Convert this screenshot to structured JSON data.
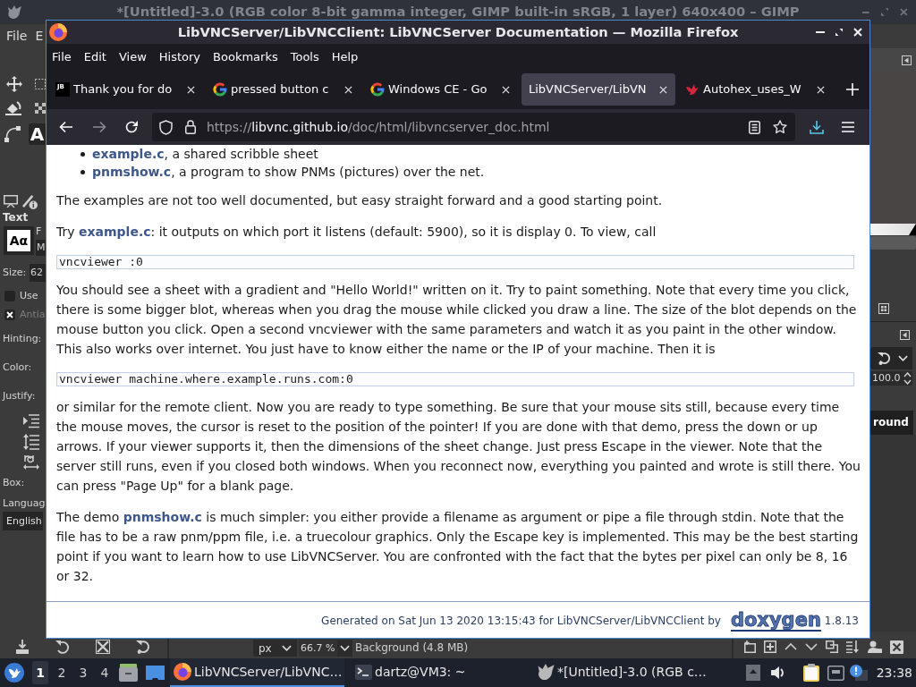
{
  "gimp": {
    "title": "*[Untitled]-3.0 (RGB color 8-bit gamma integer, GIMP built-in sRGB, 1 layer) 640x400 – GIMP",
    "menu": [
      "File",
      "E"
    ],
    "active_tool": "A",
    "tool_options": {
      "heading": "Text",
      "font_preview": "Aα",
      "font_label": "F",
      "font_value": "M",
      "size_label": "Size:",
      "size_value": "62",
      "toggles": [
        {
          "label": "Use",
          "checked": false,
          "disabled": false
        },
        {
          "label": "Antia",
          "checked": true,
          "disabled": true
        }
      ],
      "hinting_label": "Hinting:",
      "color_label": "Color:",
      "justify_label": "Justify:",
      "box_label": "Box:",
      "language_label": "Languag",
      "language_value": "English"
    },
    "layers_panel": {
      "spin_value": "100.0",
      "layer_name": "round"
    },
    "status_bar": {
      "unit": "px",
      "zoom": "66.7 %",
      "info": "Background (4.8 MB)"
    }
  },
  "firefox": {
    "title": "LibVNCServer/LibVNCClient: LibVNCServer Documentation — Mozilla Firefox",
    "menu": [
      "File",
      "Edit",
      "View",
      "History",
      "Bookmarks",
      "Tools",
      "Help"
    ],
    "tabs": [
      {
        "kind": "letters",
        "icon_text": "JB",
        "label": "Thank you for do",
        "selected": false
      },
      {
        "kind": "g",
        "label": "pressed button c",
        "selected": false
      },
      {
        "kind": "g",
        "label": "Windows CE - Go",
        "selected": false
      },
      {
        "kind": "none",
        "label": "LibVNCServer/LibVN",
        "selected": true
      },
      {
        "kind": "bird",
        "label": "Autohex_uses_W",
        "selected": false
      }
    ],
    "address": {
      "scheme": "https://",
      "host": "libvnc.github.io",
      "path": "/doc/html/libvncserver_doc.html"
    },
    "content": [
      {
        "kind": "list",
        "items": [
          {
            "parts": [
              {
                "kind": "link",
                "text": "example.c"
              },
              {
                "kind": "text",
                "text": ", a shared scribble sheet"
              }
            ]
          },
          {
            "parts": [
              {
                "kind": "link",
                "text": "pnmshow.c"
              },
              {
                "kind": "text",
                "text": ", a program to show PNMs (pictures) over the net."
              }
            ]
          }
        ]
      },
      {
        "kind": "paragraph",
        "parts": [
          {
            "kind": "text",
            "text": "The examples are not too well documented, but easy straight forward and a good starting point."
          }
        ]
      },
      {
        "kind": "paragraph",
        "parts": [
          {
            "kind": "text",
            "text": "Try "
          },
          {
            "kind": "link",
            "text": "example.c"
          },
          {
            "kind": "text",
            "text": ": it outputs on which port it listens (default: 5900), so it is display 0. To view, call"
          }
        ]
      },
      {
        "kind": "code",
        "text": "vncviewer :0"
      },
      {
        "kind": "paragraph",
        "parts": [
          {
            "kind": "text",
            "text": "You should see a sheet with a gradient and \"Hello World!\" written on it. Try to paint something. Note that every time you click, there is some bigger blot, whereas when you drag the mouse while clicked you draw a line. The size of the blot depends on the mouse button you click. Open a second vncviewer with the same parameters and watch it as you paint in the other window. This also works over internet. You just have to know either the name or the IP of your machine. Then it is"
          }
        ]
      },
      {
        "kind": "code",
        "text": "vncviewer machine.where.example.runs.com:0"
      },
      {
        "kind": "paragraph",
        "parts": [
          {
            "kind": "text",
            "text": "or similar for the remote client. Now you are ready to type something. Be sure that your mouse sits still, because every time the mouse moves, the cursor is reset to the position of the pointer! If you are done with that demo, press the down or up arrows. If your viewer supports it, then the dimensions of the sheet change. Just press Escape in the viewer. Note that the server still runs, even if you closed both windows. When you reconnect now, everything you painted and wrote is still there. You can press \"Page Up\" for a blank page."
          }
        ]
      },
      {
        "kind": "paragraph",
        "parts": [
          {
            "kind": "text",
            "text": "The demo "
          },
          {
            "kind": "link",
            "text": "pnmshow.c"
          },
          {
            "kind": "text",
            "text": " is much simpler: you either provide a filename as argument or pipe a file through stdin. Note that the file has to be a raw pnm/ppm file, i.e. a truecolour graphics. Only the Escape key is implemented. This may be the best starting point if you want to learn how to use LibVNCServer. You are confronted with the fact that the bytes per pixel can only be 8, 16 or 32."
          }
        ]
      }
    ],
    "footer": {
      "text": "Generated on Sat Jun 13 2020 13:15:43 for LibVNCServer/LibVNCClient by",
      "logo": "doxygen",
      "version": "1.8.13"
    }
  },
  "taskbar": {
    "workspaces": [
      {
        "label": "1",
        "selected": true
      },
      {
        "label": "2",
        "selected": false
      },
      {
        "label": "3",
        "selected": false
      },
      {
        "label": "4",
        "selected": false
      }
    ],
    "tasks": [
      {
        "kind": "browser",
        "label": "LibVNCServer/LibVNC…",
        "selected": true
      },
      {
        "kind": "terminal",
        "label": "dartz@VM3: ~",
        "selected": false
      },
      {
        "kind": "mascot",
        "label": "*[Untitled]-3.0 (RGB c…",
        "selected": false
      }
    ],
    "clock": "23:38"
  }
}
